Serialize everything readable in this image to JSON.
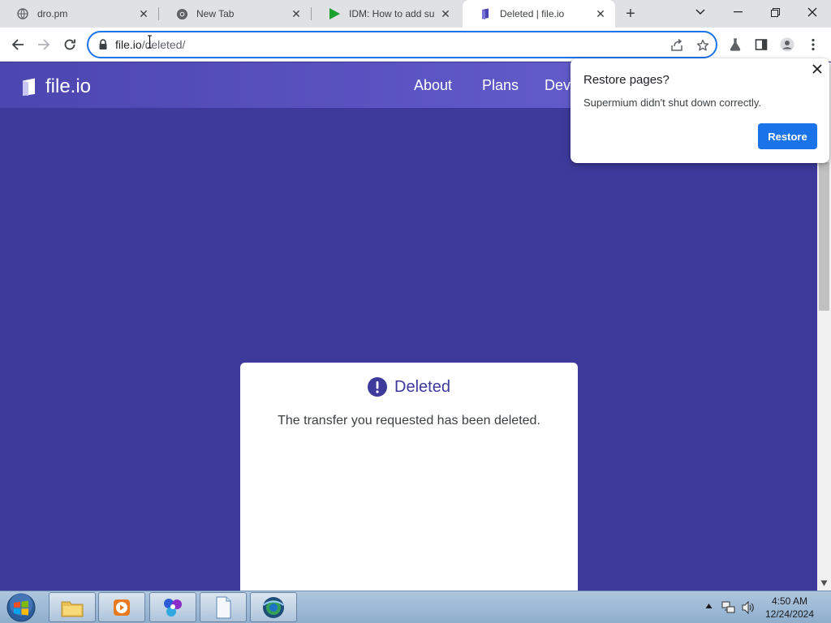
{
  "browser": {
    "tabs": [
      {
        "title": "dro.pm",
        "icon": "globe-icon",
        "active": false
      },
      {
        "title": "New Tab",
        "icon": "chrome-icon",
        "active": false
      },
      {
        "title": "IDM: How to add supp",
        "icon": "idm-play-icon",
        "active": false
      },
      {
        "title": "Deleted | file.io",
        "icon": "fileio-icon",
        "active": true
      }
    ],
    "address": {
      "host": "file.io",
      "path": "/deleted/"
    }
  },
  "site": {
    "logo_text": "file.io",
    "nav": [
      {
        "label": "About"
      },
      {
        "label": "Plans"
      },
      {
        "label": "Dev"
      }
    ],
    "card": {
      "title": "Deleted",
      "message": "The transfer you requested has been deleted."
    }
  },
  "popup": {
    "title": "Restore pages?",
    "message": "Supermium didn't shut down correctly.",
    "button": "Restore"
  },
  "taskbar": {
    "clock_time": "4:50 AM",
    "clock_date": "12/24/2024"
  },
  "colors": {
    "page_bg": "#3d3a9c",
    "accent": "#1a73e8",
    "header_bg": "#5e57c6"
  }
}
